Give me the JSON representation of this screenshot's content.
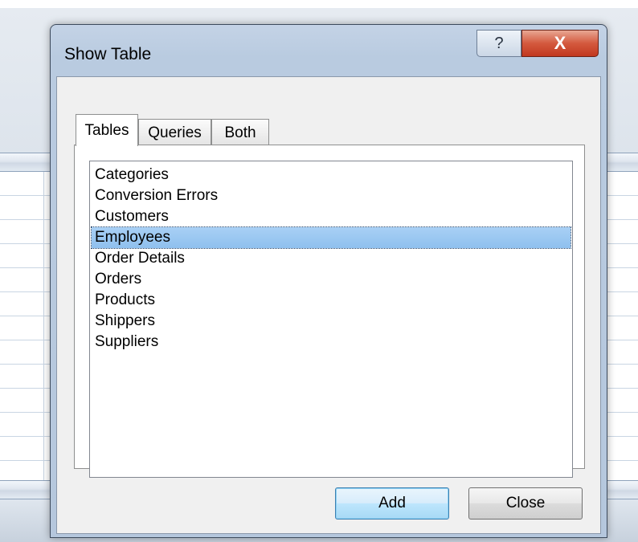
{
  "dialog": {
    "title": "Show Table",
    "help_glyph": "?",
    "close_glyph": "X"
  },
  "tabs": [
    {
      "label": "Tables",
      "active": true
    },
    {
      "label": "Queries",
      "active": false
    },
    {
      "label": "Both",
      "active": false
    }
  ],
  "list": {
    "items": [
      "Categories",
      "Conversion Errors",
      "Customers",
      "Employees",
      "Order Details",
      "Orders",
      "Products",
      "Shippers",
      "Suppliers"
    ],
    "selected": "Employees"
  },
  "buttons": {
    "add_label": "Add",
    "close_label": "Close"
  },
  "colors": {
    "selection": "#99c9f3",
    "title_close": "#c9452a",
    "frame": "#b9cbe0"
  }
}
